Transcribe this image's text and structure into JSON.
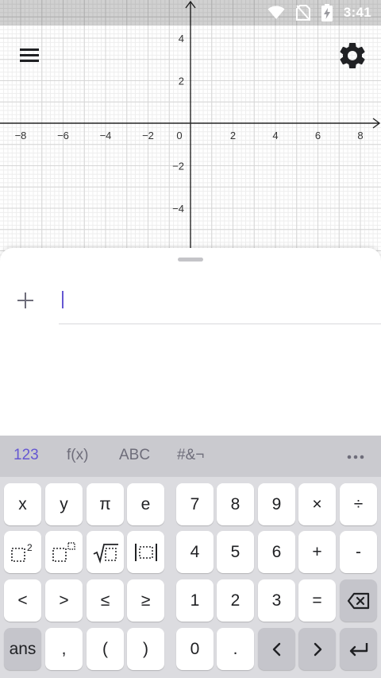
{
  "status_bar": {
    "time": "3:41",
    "icons": [
      "wifi-icon",
      "no-sim-icon",
      "battery-charging-icon"
    ]
  },
  "graph": {
    "x_ticks": [
      "−8",
      "−6",
      "−4",
      "−2",
      "0",
      "2",
      "4",
      "6",
      "8"
    ],
    "y_ticks": [
      "4",
      "2",
      "−2",
      "−4"
    ],
    "icons": {
      "menu": "menu-icon",
      "settings": "gear-icon"
    }
  },
  "algebra": {
    "add_icon": "plus-icon",
    "input_value": ""
  },
  "keyboard": {
    "tabs": [
      "123",
      "f(x)",
      "ABC",
      "#&¬"
    ],
    "active_tab": "123",
    "more_icon": "more-horizontal-icon",
    "accent": "#6557d2",
    "rows": [
      [
        "x",
        "y",
        "π",
        "e",
        "7",
        "8",
        "9",
        "×",
        "÷"
      ],
      [
        "",
        "",
        "",
        "",
        "4",
        "5",
        "6",
        "+",
        "-"
      ],
      [
        "<",
        ">",
        "≤",
        "≥",
        "1",
        "2",
        "3",
        "=",
        ""
      ],
      [
        "ans",
        ",",
        "(",
        ")",
        "0",
        ".",
        "",
        "",
        ""
      ]
    ],
    "icons": {
      "squared": "square-superscript-icon",
      "power": "power-icon",
      "sqrt": "square-root-icon",
      "abs": "absolute-value-icon",
      "backspace": "backspace-icon",
      "left": "arrow-left-icon",
      "right": "arrow-right-icon",
      "enter": "enter-icon"
    }
  }
}
